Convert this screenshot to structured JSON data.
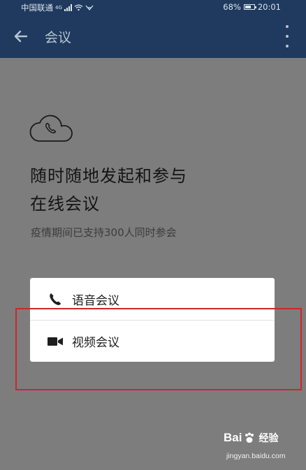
{
  "status_bar": {
    "carrier": "中国联通",
    "network": "4G",
    "battery": "68%",
    "battery_level": 0.68,
    "time": "20:01"
  },
  "app_bar": {
    "title": "会议",
    "back_icon": "arrow-left-icon",
    "menu_icon": "more-vertical-icon"
  },
  "main": {
    "illustration_icon": "cloud-phone-icon",
    "headline_line1": "随时随地发起和参与",
    "headline_line2": "在线会议",
    "subtitle": "疫情期间已支持300人同时参会"
  },
  "options": [
    {
      "label": "语音会议",
      "icon": "phone-icon"
    },
    {
      "label": "视频会议",
      "icon": "video-camera-icon"
    }
  ],
  "highlight_color": "#d0242c",
  "watermark": {
    "logo": "Bai",
    "logo_suffix": "经验",
    "url": "jingyan.baidu.com"
  }
}
